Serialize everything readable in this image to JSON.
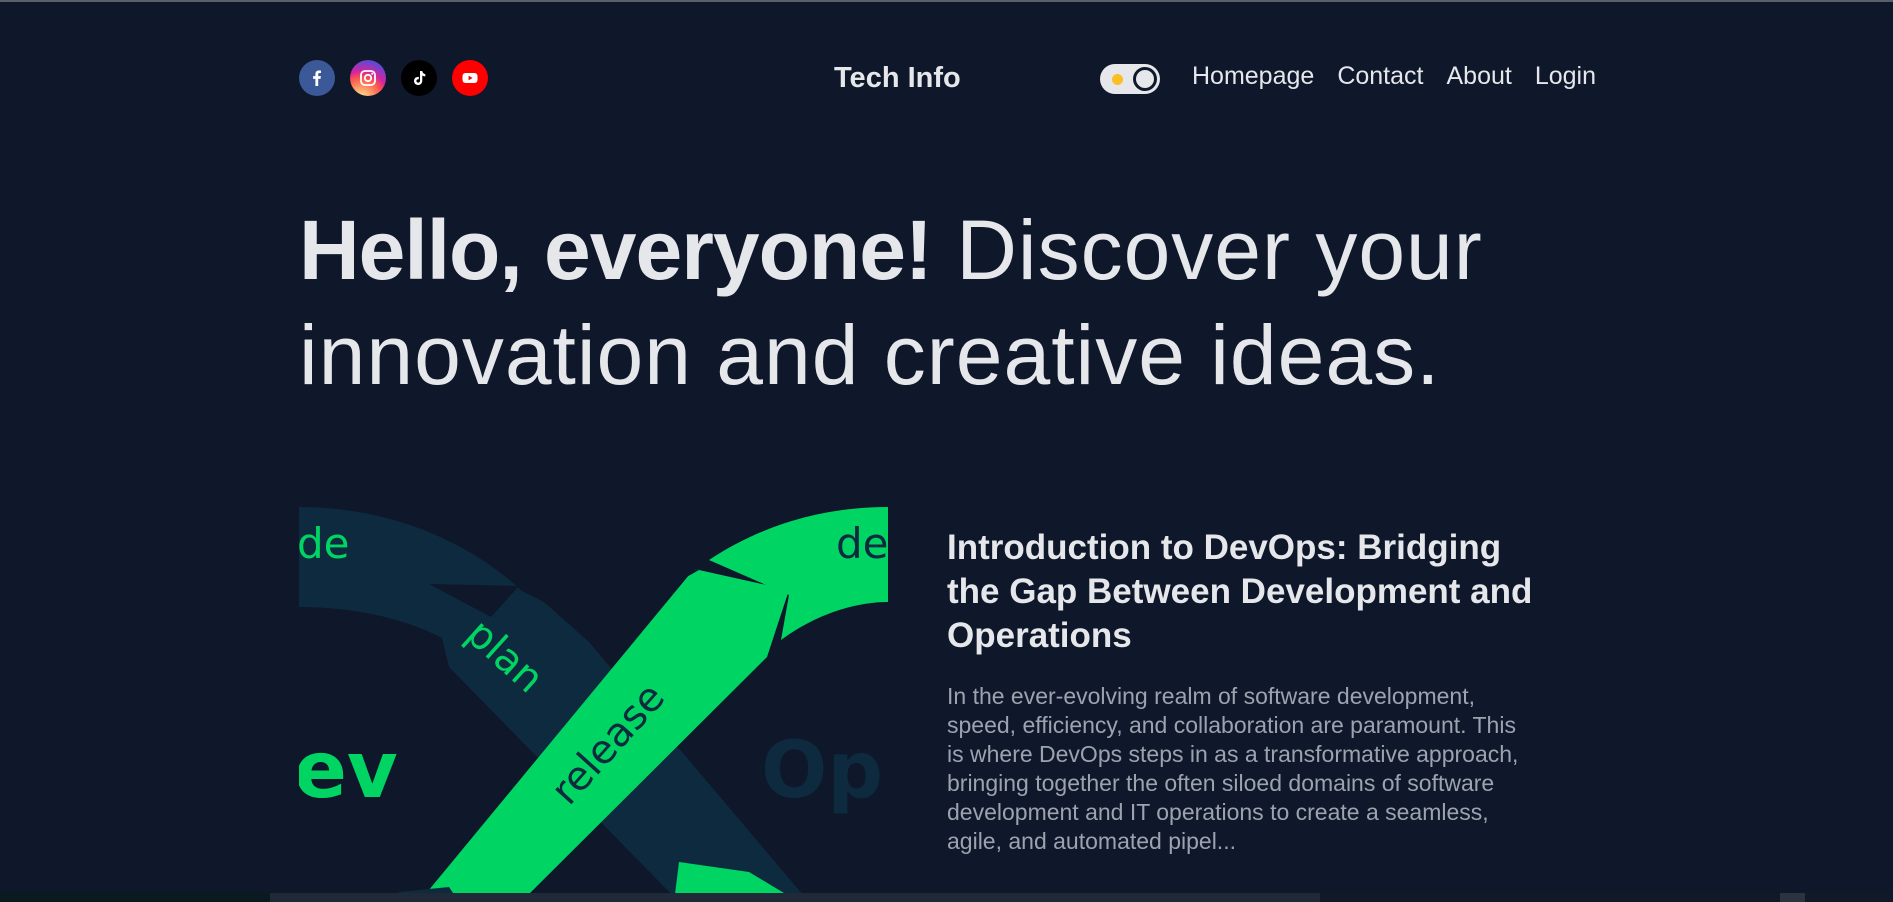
{
  "nav": {
    "brand": "Tech Info",
    "socials": [
      {
        "icon": "facebook-icon",
        "color": "#3b5998"
      },
      {
        "icon": "instagram-icon",
        "color": "#d6249f"
      },
      {
        "icon": "tiktok-icon",
        "color": "#000000"
      },
      {
        "icon": "youtube-icon",
        "color": "#ff0000"
      }
    ],
    "theme_toggle": {
      "state": "light",
      "icon": "sun-icon"
    },
    "links": [
      "Homepage",
      "Contact",
      "About",
      "Login"
    ]
  },
  "hero": {
    "bold": "Hello, everyone!",
    "rest": " Discover your innovation and creative ideas."
  },
  "article": {
    "image_words": {
      "top_left": "de",
      "top_right": "de",
      "plan": "plan",
      "release": "release",
      "dev": "ev",
      "ops": "Op"
    },
    "title": "Introduction to DevOps: Bridging the Gap Between Development and Operations",
    "excerpt": "In the ever-evolving realm of software development, speed, efficiency, and collaboration are paramount. This is where DevOps steps in as a transformative approach, bringing together the often siloed domains of software development and IT operations to create a seamless, agile, and automated pipel..."
  },
  "colors": {
    "background": "#0f172a",
    "text": "#e5e7eb",
    "muted": "#9ca3af",
    "green": "#00d563",
    "navy": "#0e2a3f"
  }
}
